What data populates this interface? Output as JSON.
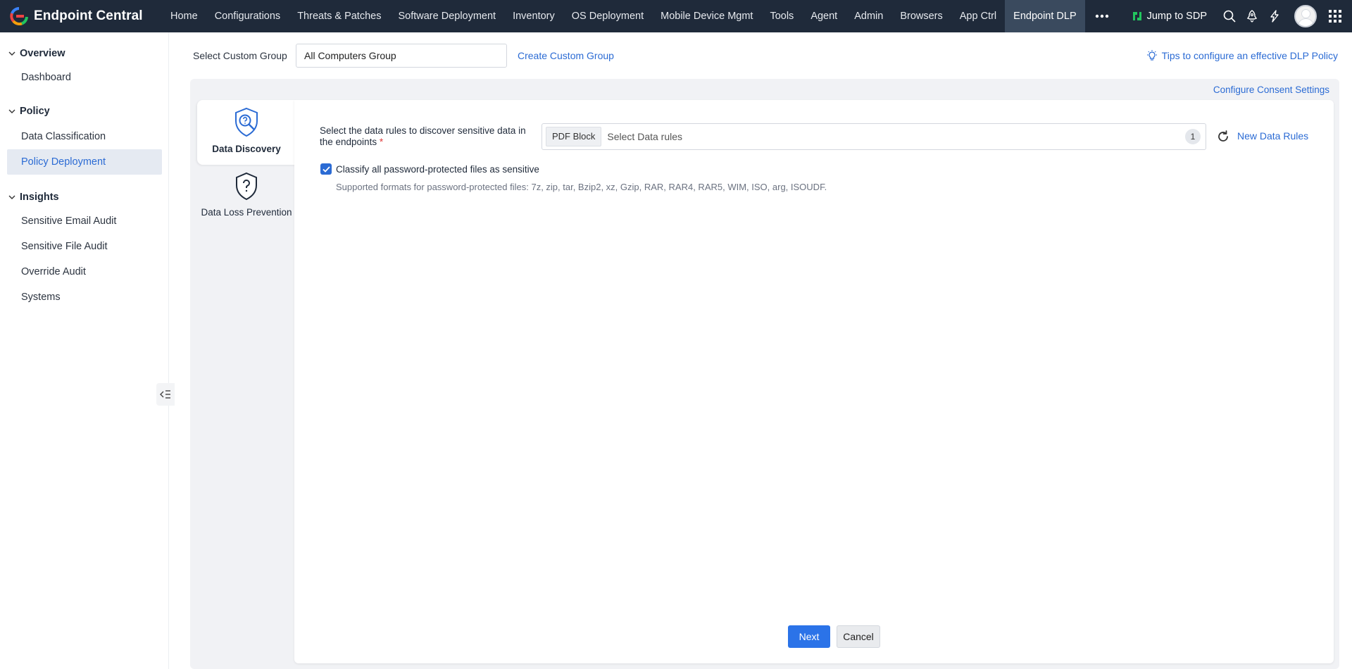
{
  "app": {
    "name": "Endpoint Central"
  },
  "nav": {
    "items": [
      "Home",
      "Configurations",
      "Threats & Patches",
      "Software Deployment",
      "Inventory",
      "OS Deployment",
      "Mobile Device Mgmt",
      "Tools",
      "Agent",
      "Admin",
      "Browsers",
      "App Ctrl",
      "Endpoint DLP"
    ],
    "active": "Endpoint DLP",
    "more_icon": "more-horizontal-icon"
  },
  "topbar": {
    "jump_label": "Jump to SDP",
    "icons": [
      "search-icon",
      "rocket-icon",
      "lightning-icon",
      "avatar",
      "app-grid-icon"
    ]
  },
  "sidebar": {
    "sections": [
      {
        "title": "Overview",
        "items": [
          "Dashboard"
        ]
      },
      {
        "title": "Policy",
        "items": [
          "Data Classification",
          "Policy Deployment"
        ]
      },
      {
        "title": "Insights",
        "items": [
          "Sensitive Email Audit",
          "Sensitive File Audit",
          "Override Audit",
          "Systems"
        ]
      }
    ],
    "active_item": "Policy Deployment"
  },
  "group": {
    "label": "Select Custom Group",
    "selected": "All Computers Group",
    "create_link": "Create Custom Group"
  },
  "tips_link": "Tips to configure an effective DLP Policy",
  "consent_link": "Configure Consent Settings",
  "steps": [
    {
      "label": "Data Discovery",
      "icon": "data-discovery-icon",
      "active": true
    },
    {
      "label": "Data Loss Prevention",
      "icon": "shield-question-icon",
      "active": false
    }
  ],
  "form": {
    "rule_label": "Select the data rules to discover sensitive data in the endpoints",
    "required_mark": "*",
    "chip": "PDF Block",
    "rule_placeholder": "Select Data rules",
    "rule_count": "1",
    "new_rules_link": "New Data Rules",
    "checkbox_label": "Classify all password-protected files as sensitive",
    "checkbox_checked": true,
    "help_text": "Supported formats for password-protected files: 7z, zip, tar, Bzip2, xz, Gzip, RAR, RAR4, RAR5, WIM, ISO, arg, ISOUDF."
  },
  "buttons": {
    "next": "Next",
    "cancel": "Cancel"
  },
  "colors": {
    "topbar": "#1f2a3a",
    "accent": "#2b6bd4",
    "primary_button": "#2b73e8"
  }
}
